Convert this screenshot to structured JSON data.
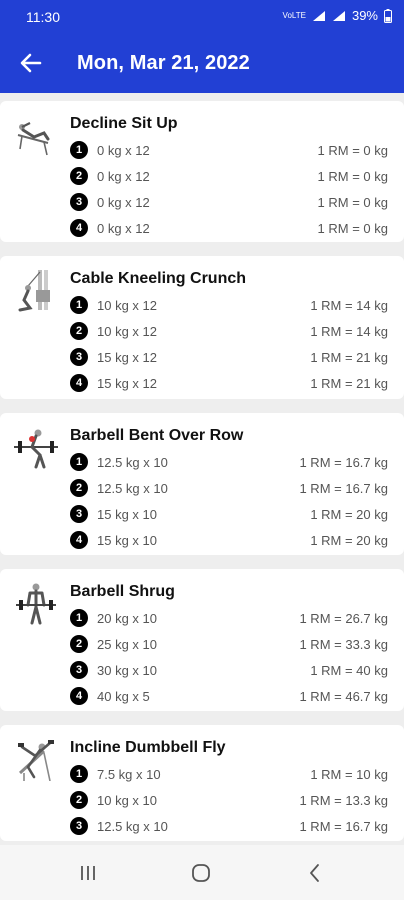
{
  "status": {
    "time": "11:30",
    "network": "VoLTE",
    "battery": "39%"
  },
  "header": {
    "title": "Mon, Mar 21, 2022"
  },
  "exercises": [
    {
      "name": "Decline Sit Up",
      "sets": [
        {
          "num": "1",
          "text": "0 kg x 12",
          "rm": "1 RM = 0 kg"
        },
        {
          "num": "2",
          "text": "0 kg x 12",
          "rm": "1 RM = 0 kg"
        },
        {
          "num": "3",
          "text": "0 kg x 12",
          "rm": "1 RM = 0 kg"
        },
        {
          "num": "4",
          "text": "0 kg x 12",
          "rm": "1 RM = 0 kg"
        }
      ]
    },
    {
      "name": "Cable Kneeling Crunch",
      "sets": [
        {
          "num": "1",
          "text": "10 kg x 12",
          "rm": "1 RM = 14 kg"
        },
        {
          "num": "2",
          "text": "10 kg x 12",
          "rm": "1 RM = 14 kg"
        },
        {
          "num": "3",
          "text": "15 kg x 12",
          "rm": "1 RM = 21 kg"
        },
        {
          "num": "4",
          "text": "15 kg x 12",
          "rm": "1 RM = 21 kg"
        }
      ]
    },
    {
      "name": "Barbell Bent Over Row",
      "sets": [
        {
          "num": "1",
          "text": "12.5 kg x 10",
          "rm": "1 RM = 16.7 kg"
        },
        {
          "num": "2",
          "text": "12.5 kg x 10",
          "rm": "1 RM = 16.7 kg"
        },
        {
          "num": "3",
          "text": "15 kg x 10",
          "rm": "1 RM = 20 kg"
        },
        {
          "num": "4",
          "text": "15 kg x 10",
          "rm": "1 RM = 20 kg"
        }
      ]
    },
    {
      "name": "Barbell Shrug",
      "sets": [
        {
          "num": "1",
          "text": "20 kg x 10",
          "rm": "1 RM = 26.7 kg"
        },
        {
          "num": "2",
          "text": "25 kg x 10",
          "rm": "1 RM = 33.3 kg"
        },
        {
          "num": "3",
          "text": "30 kg x 10",
          "rm": "1 RM = 40 kg"
        },
        {
          "num": "4",
          "text": "40 kg x 5",
          "rm": "1 RM = 46.7 kg"
        }
      ]
    },
    {
      "name": "Incline Dumbbell Fly",
      "sets": [
        {
          "num": "1",
          "text": "7.5 kg x 10",
          "rm": "1 RM = 10 kg"
        },
        {
          "num": "2",
          "text": "10 kg x 10",
          "rm": "1 RM = 13.3 kg"
        },
        {
          "num": "3",
          "text": "12.5 kg x 10",
          "rm": "1 RM = 16.7 kg"
        }
      ]
    }
  ],
  "colors": {
    "header": "#2240d4",
    "background": "#eeeeee",
    "card": "#ffffff",
    "set_badge": "#000000"
  }
}
